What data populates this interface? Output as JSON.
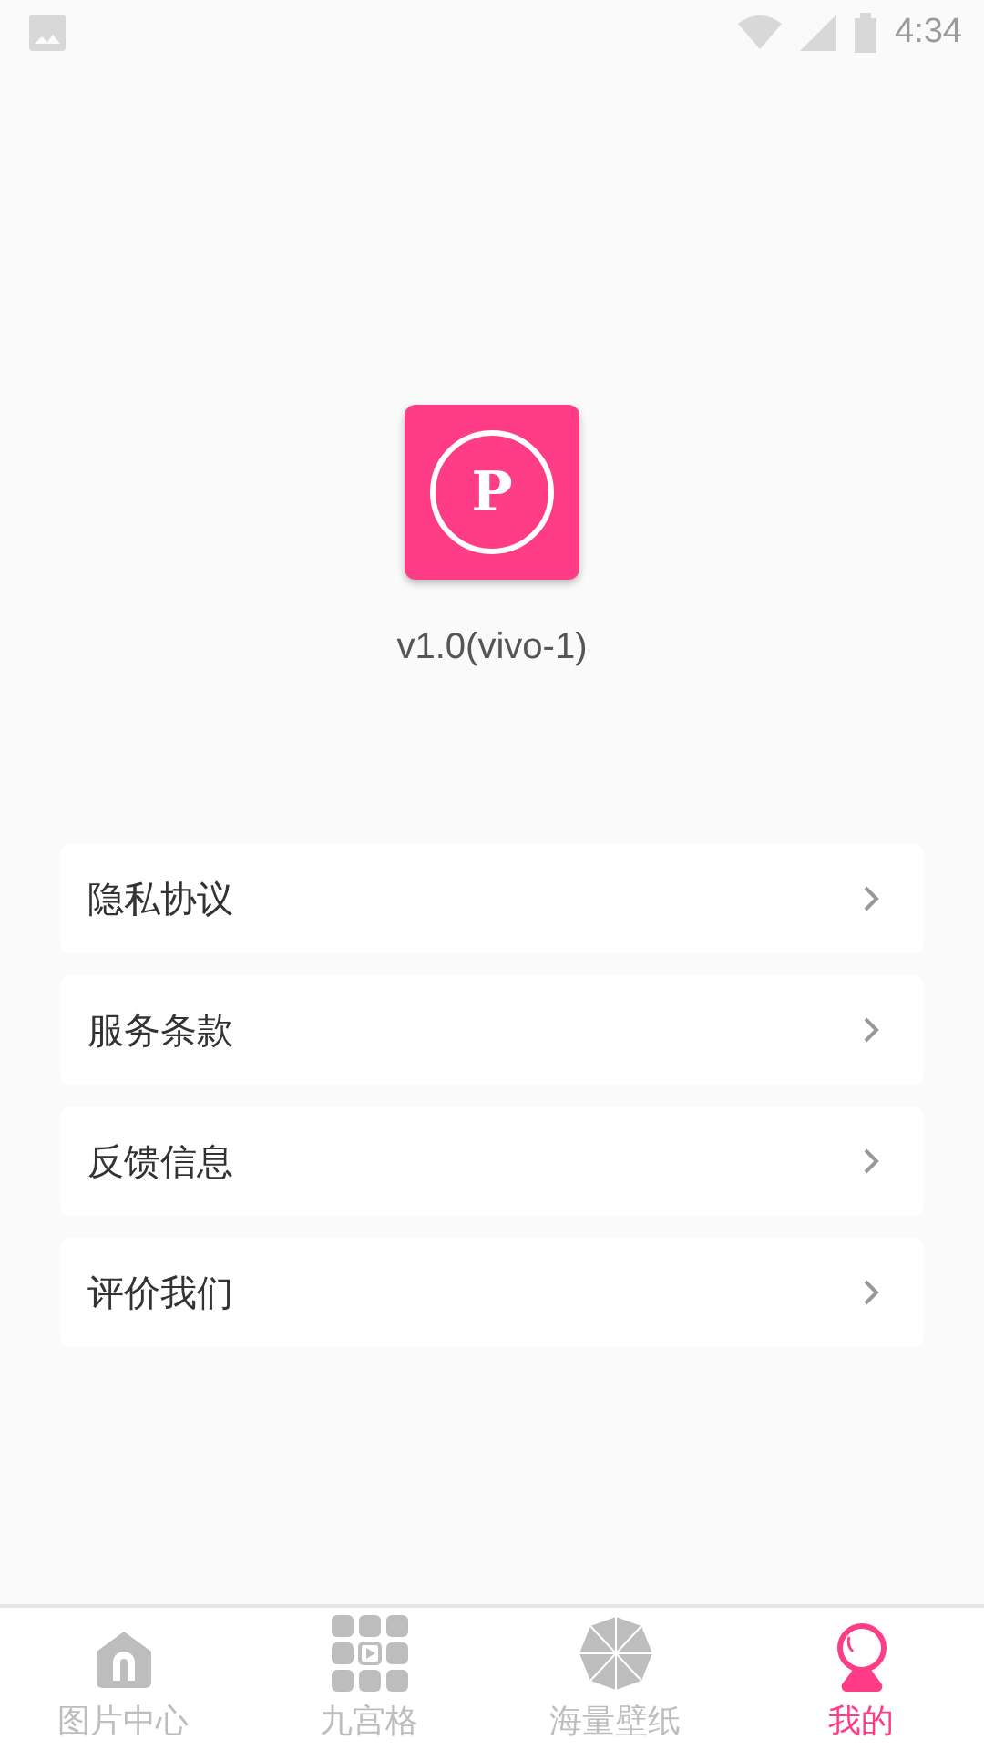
{
  "status_bar": {
    "time": "4:34"
  },
  "app": {
    "logo_letter": "P",
    "version": "v1.0(vivo-1)"
  },
  "menu": [
    {
      "label": "隐私协议"
    },
    {
      "label": "服务条款"
    },
    {
      "label": "反馈信息"
    },
    {
      "label": "评价我们"
    }
  ],
  "tabs": [
    {
      "label": "图片中心",
      "kind": "home",
      "selected": false
    },
    {
      "label": "九宫格",
      "kind": "grid",
      "selected": false
    },
    {
      "label": "海量壁纸",
      "kind": "umbrella",
      "selected": false
    },
    {
      "label": "我的",
      "kind": "profile",
      "selected": true
    }
  ]
}
